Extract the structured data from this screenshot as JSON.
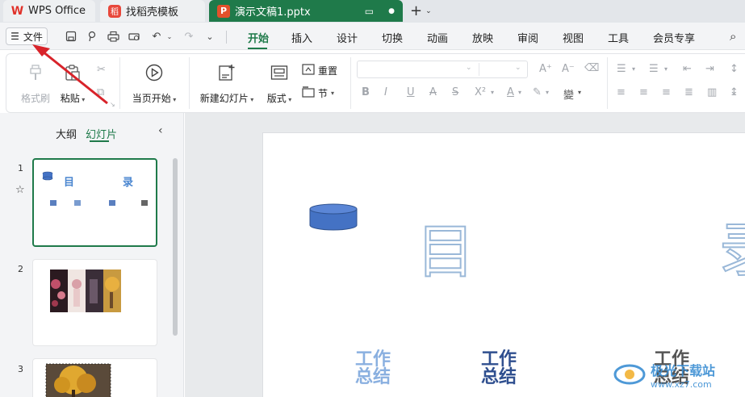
{
  "titlebar": {
    "tab_wps": "WPS Office",
    "tab_template": "找稻壳模板",
    "tab_doc": "演示文稿1.pptx"
  },
  "menubar": {
    "file_label": "文件",
    "items": [
      "开始",
      "插入",
      "设计",
      "切换",
      "动画",
      "放映",
      "审阅",
      "视图",
      "工具",
      "会员专享"
    ]
  },
  "ribbon": {
    "format_painter": "格式刷",
    "paste": "粘贴",
    "play_from_current": "当页开始",
    "new_slide": "新建幻灯片",
    "layout": "版式",
    "reset": "重置",
    "section": "节"
  },
  "left_pane": {
    "tab_outline": "大纲",
    "tab_slides": "幻灯片",
    "slide_numbers": [
      "1",
      "2",
      "3"
    ],
    "thumb1_title_a": "目",
    "thumb1_title_b": "录"
  },
  "slide": {
    "title_left": "目",
    "title_right": "录",
    "items": [
      "工作\n总结",
      "工作\n总结",
      "工作\n总结"
    ]
  },
  "watermark": {
    "title": "极光下载站",
    "sub": "www.xz7.com"
  },
  "colors": {
    "accent": "#1f7a4a",
    "arrow": "#d8232a",
    "shape_blue": "#4472c4"
  }
}
